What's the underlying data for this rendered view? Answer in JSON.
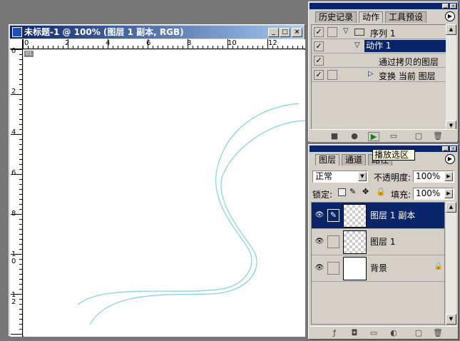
{
  "document_window": {
    "title": "未标题-1 @ 100% (图层 1 副本, RGB)",
    "buttons": {
      "minimize": "_",
      "maximize": "□",
      "close": "×"
    },
    "ruler_h_labels": [
      "0",
      "2",
      "4",
      "6",
      "8",
      "10",
      "12"
    ],
    "ruler_v_labels": [
      "0",
      "2",
      "4",
      "6",
      "8",
      "1 0",
      "1 2"
    ],
    "badge": "01"
  },
  "actions_panel": {
    "tabs": [
      "历史记录",
      "动作",
      "工具预设"
    ],
    "active_tab": 1,
    "rows": [
      {
        "checked": true,
        "has_dialog": false,
        "expand": "▽",
        "label": "序列 1",
        "icon": "folder-icon",
        "selected": false
      },
      {
        "checked": true,
        "has_dialog": false,
        "expand": "▽",
        "label": "动作 1",
        "selected": true
      },
      {
        "checked": true,
        "has_dialog": false,
        "expand": "",
        "label": "通过拷贝的图层",
        "selected": false
      },
      {
        "checked": true,
        "has_dialog": false,
        "expand": "▷",
        "label": "变换 当前 图层",
        "selected": false
      }
    ],
    "bottom_icons": [
      "stop-icon",
      "record-icon",
      "play-icon",
      "new-set-icon",
      "new-action-icon",
      "delete-icon"
    ],
    "tooltip": "播放选区"
  },
  "layers_panel": {
    "tabs": [
      "图层",
      "通道",
      "路径"
    ],
    "active_tab": 0,
    "blend_mode": "正常",
    "opacity_label": "不透明度:",
    "opacity_value": "100%",
    "lock_label": "锁定:",
    "fill_label": "填充:",
    "fill_value": "100%",
    "layers": [
      {
        "name": "图层 1 副本",
        "selected": true,
        "transparent": true,
        "brush": true,
        "locked": false
      },
      {
        "name": "图层 1",
        "selected": false,
        "transparent": true,
        "brush": false,
        "locked": false
      },
      {
        "name": "背景",
        "selected": false,
        "transparent": false,
        "brush": false,
        "locked": true
      }
    ],
    "bottom_icons": [
      "link-icon",
      "layer-style-icon",
      "mask-icon",
      "new-group-icon",
      "adjustment-icon",
      "new-layer-icon",
      "delete-icon"
    ]
  },
  "colors": {
    "title_active": "#0a246a",
    "selection": "#0a246a",
    "curve": "#7fd1e6",
    "panel_bg": "#d4d0c8"
  }
}
